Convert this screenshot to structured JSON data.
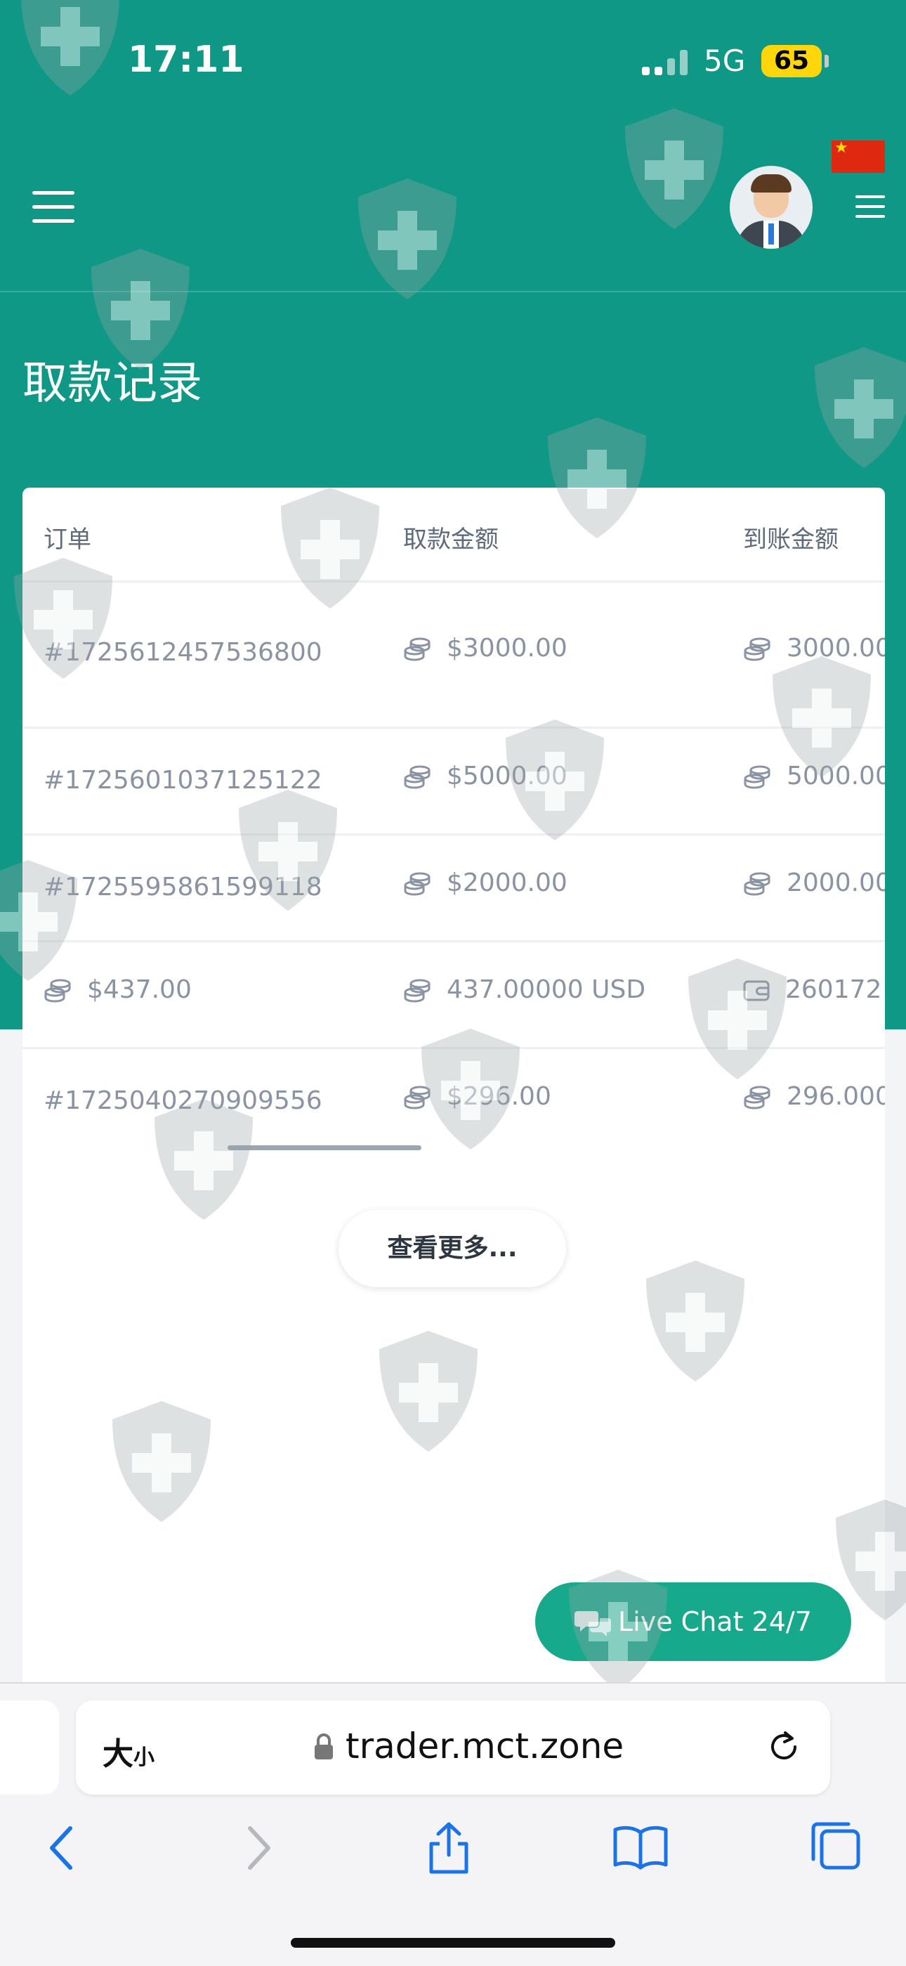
{
  "status_bar": {
    "time": "17:11",
    "network": "5G",
    "battery": "65"
  },
  "header": {
    "language_flag": "china-flag",
    "avatar": "user-avatar"
  },
  "page": {
    "title": "取款记录"
  },
  "table": {
    "columns": [
      "订单",
      "取款金额",
      "到账金额"
    ],
    "rows": [
      {
        "order": "#1725612457536800",
        "amount": "$3000.00",
        "received": "3000.00"
      },
      {
        "order": "#1725601037125122",
        "amount": "$5000.00",
        "received": "5000.00"
      },
      {
        "order": "#1725595861599118",
        "amount": "$2000.00",
        "received": "2000.00"
      },
      {
        "order": "$437.00",
        "amount": "437.00000 USD",
        "received": "260172"
      },
      {
        "order": "#1725040270909556",
        "amount": "$296.00",
        "received": "296.000"
      }
    ]
  },
  "actions": {
    "view_more": "查看更多...",
    "live_chat": "Live Chat 24/7"
  },
  "browser": {
    "text_size": "大",
    "text_size_small": "小",
    "url": "trader.mct.zone"
  },
  "colors": {
    "brand_teal": "#0e9885",
    "chat_green": "#17a98b"
  }
}
